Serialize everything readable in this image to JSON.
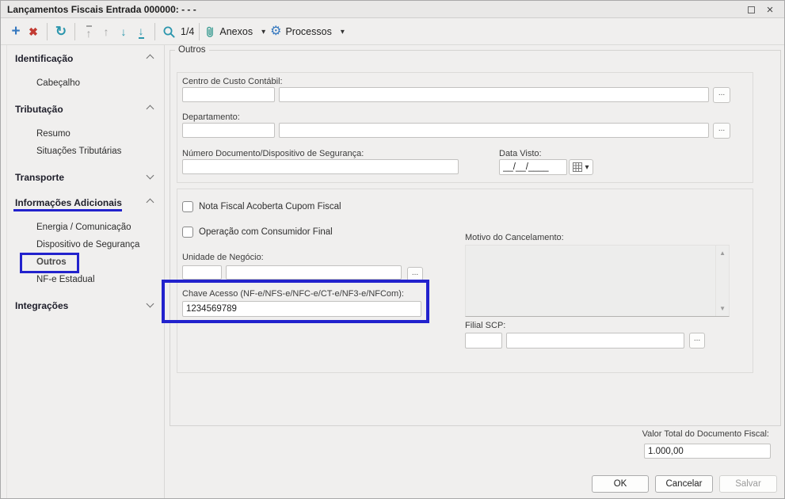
{
  "window": {
    "title": "Lançamentos Fiscais Entrada 000000: - - -"
  },
  "toolbar": {
    "record_indicator": "1/4",
    "anexos_label": "Anexos",
    "processos_label": "Processos"
  },
  "icons": {
    "add": "+",
    "delete": "✖",
    "refresh": "↻",
    "up": "↑",
    "down": "↓",
    "caret": "▾",
    "gear": "⚙",
    "scroll_up": "▲",
    "scroll_down": "▼",
    "close": "×",
    "ellipsis": "..."
  },
  "sidebar": {
    "sections": [
      {
        "label": "Identificação",
        "expanded": true,
        "items": [
          "Cabeçalho"
        ]
      },
      {
        "label": "Tributação",
        "expanded": true,
        "items": [
          "Resumo",
          "Situações Tributárias"
        ]
      },
      {
        "label": "Transporte",
        "expanded": false,
        "items": []
      },
      {
        "label": "Informações Adicionais",
        "expanded": true,
        "items": [
          "Energia / Comunicação",
          "Dispositivo de Segurança",
          "Outros",
          "NF-e Estadual"
        ],
        "active_item": "Outros"
      },
      {
        "label": "Integrações",
        "expanded": false,
        "items": []
      }
    ]
  },
  "main": {
    "group_title": "Outros",
    "centro_custo_label": "Centro de Custo Contábil:",
    "departamento_label": "Departamento:",
    "numero_doc_label": "Número Documento/Dispositivo de Segurança:",
    "data_visto_label": "Data Visto:",
    "data_visto_value": "__/__/____",
    "checkbox_nota_fiscal": "Nota Fiscal  Acoberta Cupom Fiscal",
    "checkbox_consumidor_final": "Operação com Consumidor Final",
    "unidade_negocio_label": "Unidade de Negócio:",
    "chave_acesso_label": "Chave Acesso (NF-e/NFS-e/NFC-e/CT-e/NF3-e/NFCom):",
    "chave_acesso_value": "1234569789",
    "motivo_cancelamento_label": "Motivo do Cancelamento:",
    "filial_scp_label": "Filial SCP:"
  },
  "footer": {
    "valor_total_label": "Valor Total do Documento Fiscal:",
    "valor_total_value": "1.000,00",
    "ok_label": "OK",
    "cancelar_label": "Cancelar",
    "salvar_label": "Salvar"
  },
  "colors": {
    "annotation_blue": "#2222cd",
    "toolbar_teal": "#2b96ad",
    "toolbar_blue": "#3578bf",
    "toolbar_red": "#c23b33",
    "background": "#f0efee"
  }
}
